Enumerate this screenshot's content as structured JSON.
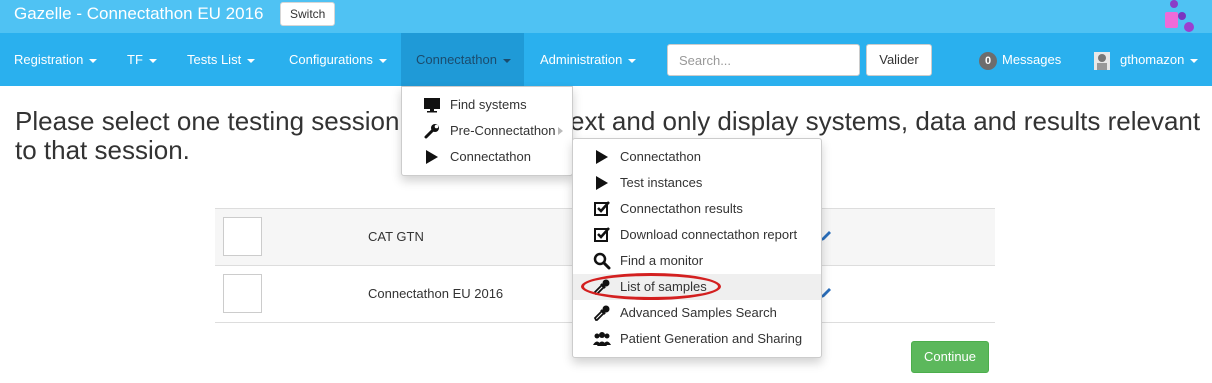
{
  "app": {
    "title": "Gazelle - Connectathon EU 2016",
    "switch_label": "Switch"
  },
  "nav": {
    "items": [
      "Registration",
      "TF",
      "Tests List",
      "Configurations",
      "Connectathon",
      "Administration"
    ],
    "active": "Connectathon",
    "search_placeholder": "Search...",
    "valider_label": "Valider",
    "messages_count": "0",
    "messages_label": "Messages",
    "user": "gthomazon"
  },
  "heading": "Please select one testing session to set the context and only display systems, data and results relevant to that session.",
  "sessions": [
    {
      "name": "CAT GTN"
    },
    {
      "name": "Connectathon EU 2016"
    }
  ],
  "continue_label": "Continue",
  "connectathon_menu": [
    {
      "label": "Find systems",
      "icon": "monitor-icon"
    },
    {
      "label": "Pre-Connectathon",
      "icon": "wrench-icon",
      "has_submenu": true
    },
    {
      "label": "Connectathon",
      "icon": "play-icon"
    }
  ],
  "connectathon_submenu": [
    {
      "label": "Connectathon",
      "icon": "play-icon"
    },
    {
      "label": "Test instances",
      "icon": "play-icon"
    },
    {
      "label": "Connectathon results",
      "icon": "checkbox-icon"
    },
    {
      "label": "Download connectathon report",
      "icon": "checkbox-icon"
    },
    {
      "label": "Find a monitor",
      "icon": "search-icon"
    },
    {
      "label": "List of samples",
      "icon": "eyedropper-icon",
      "highlighted": true
    },
    {
      "label": "Advanced Samples Search",
      "icon": "eyedropper-icon"
    },
    {
      "label": "Patient Generation and Sharing",
      "icon": "users-icon"
    }
  ],
  "colors": {
    "topbar": "#4fc2f3",
    "navbar": "#2ab0ee",
    "nav_active": "#1f9ad7",
    "continue": "#5cb85c",
    "annotation": "#d32020"
  }
}
